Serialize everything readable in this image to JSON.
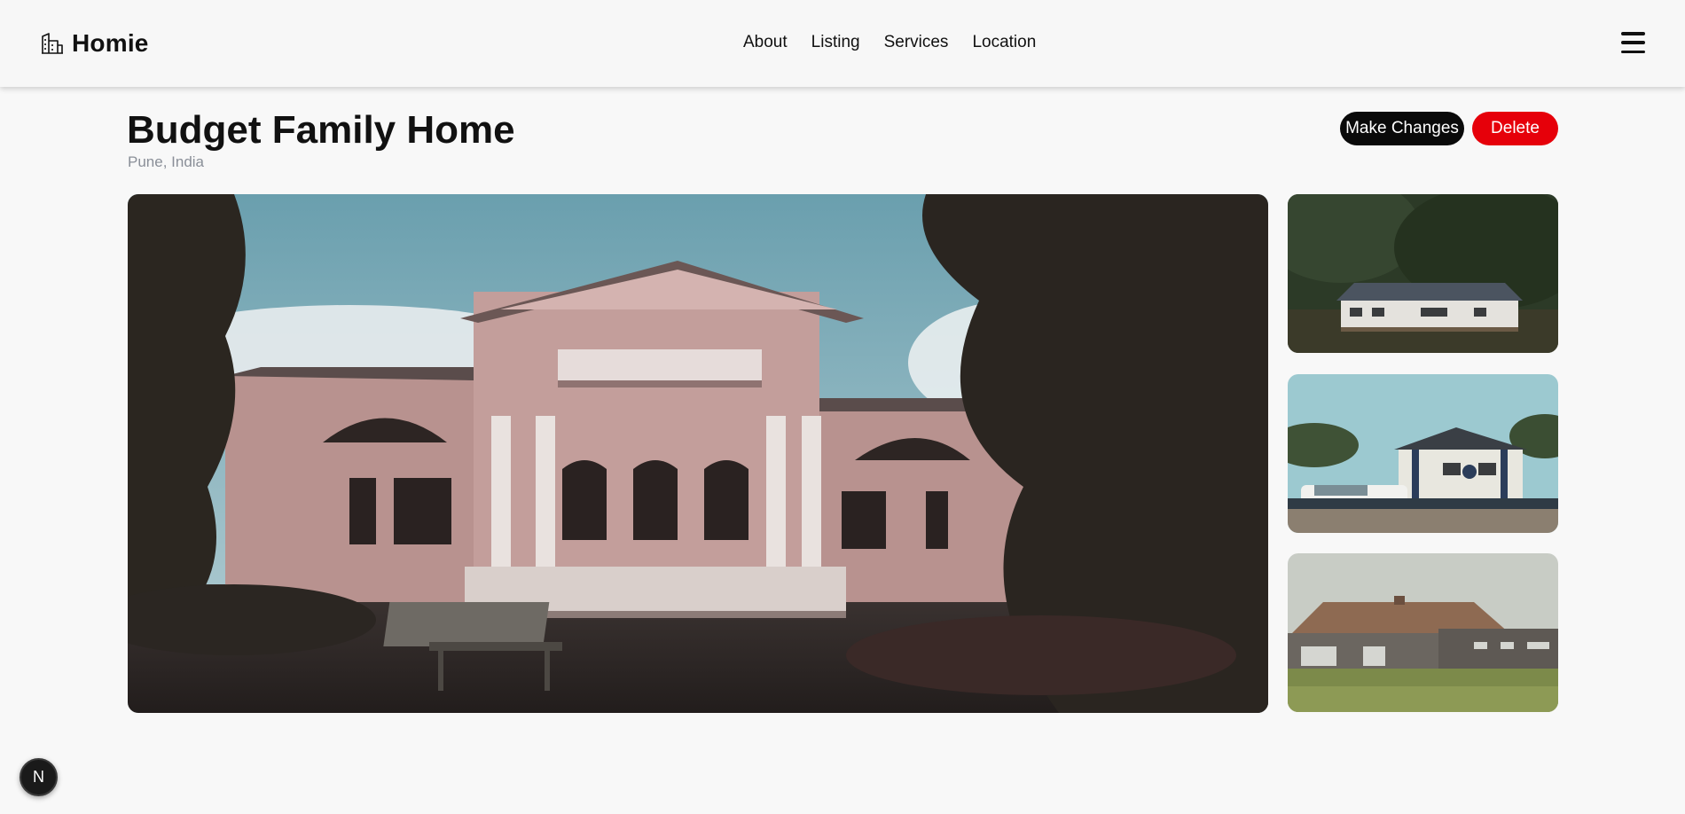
{
  "brand": {
    "name": "Homie",
    "icon": "building-icon"
  },
  "nav": {
    "items": [
      {
        "label": "About"
      },
      {
        "label": "Listing"
      },
      {
        "label": "Services"
      },
      {
        "label": "Location"
      }
    ],
    "menu_icon": "hamburger-menu-icon"
  },
  "listing": {
    "title": "Budget Family Home",
    "location": "Pune, India",
    "edit_label": "Make Changes",
    "delete_label": "Delete",
    "photos": [
      {
        "name": "main-photo",
        "desc": "pink-mansion"
      },
      {
        "name": "thumb-1",
        "desc": "house-in-forest"
      },
      {
        "name": "thumb-2",
        "desc": "house-with-truck"
      },
      {
        "name": "thumb-3",
        "desc": "brown-roof-house"
      }
    ]
  },
  "dev_badge": {
    "label": "N"
  },
  "colors": {
    "background": "#f8f8f8",
    "edit_button": "#0a0a0a",
    "delete_button": "#e6000a",
    "location_text": "#8a8f98"
  }
}
